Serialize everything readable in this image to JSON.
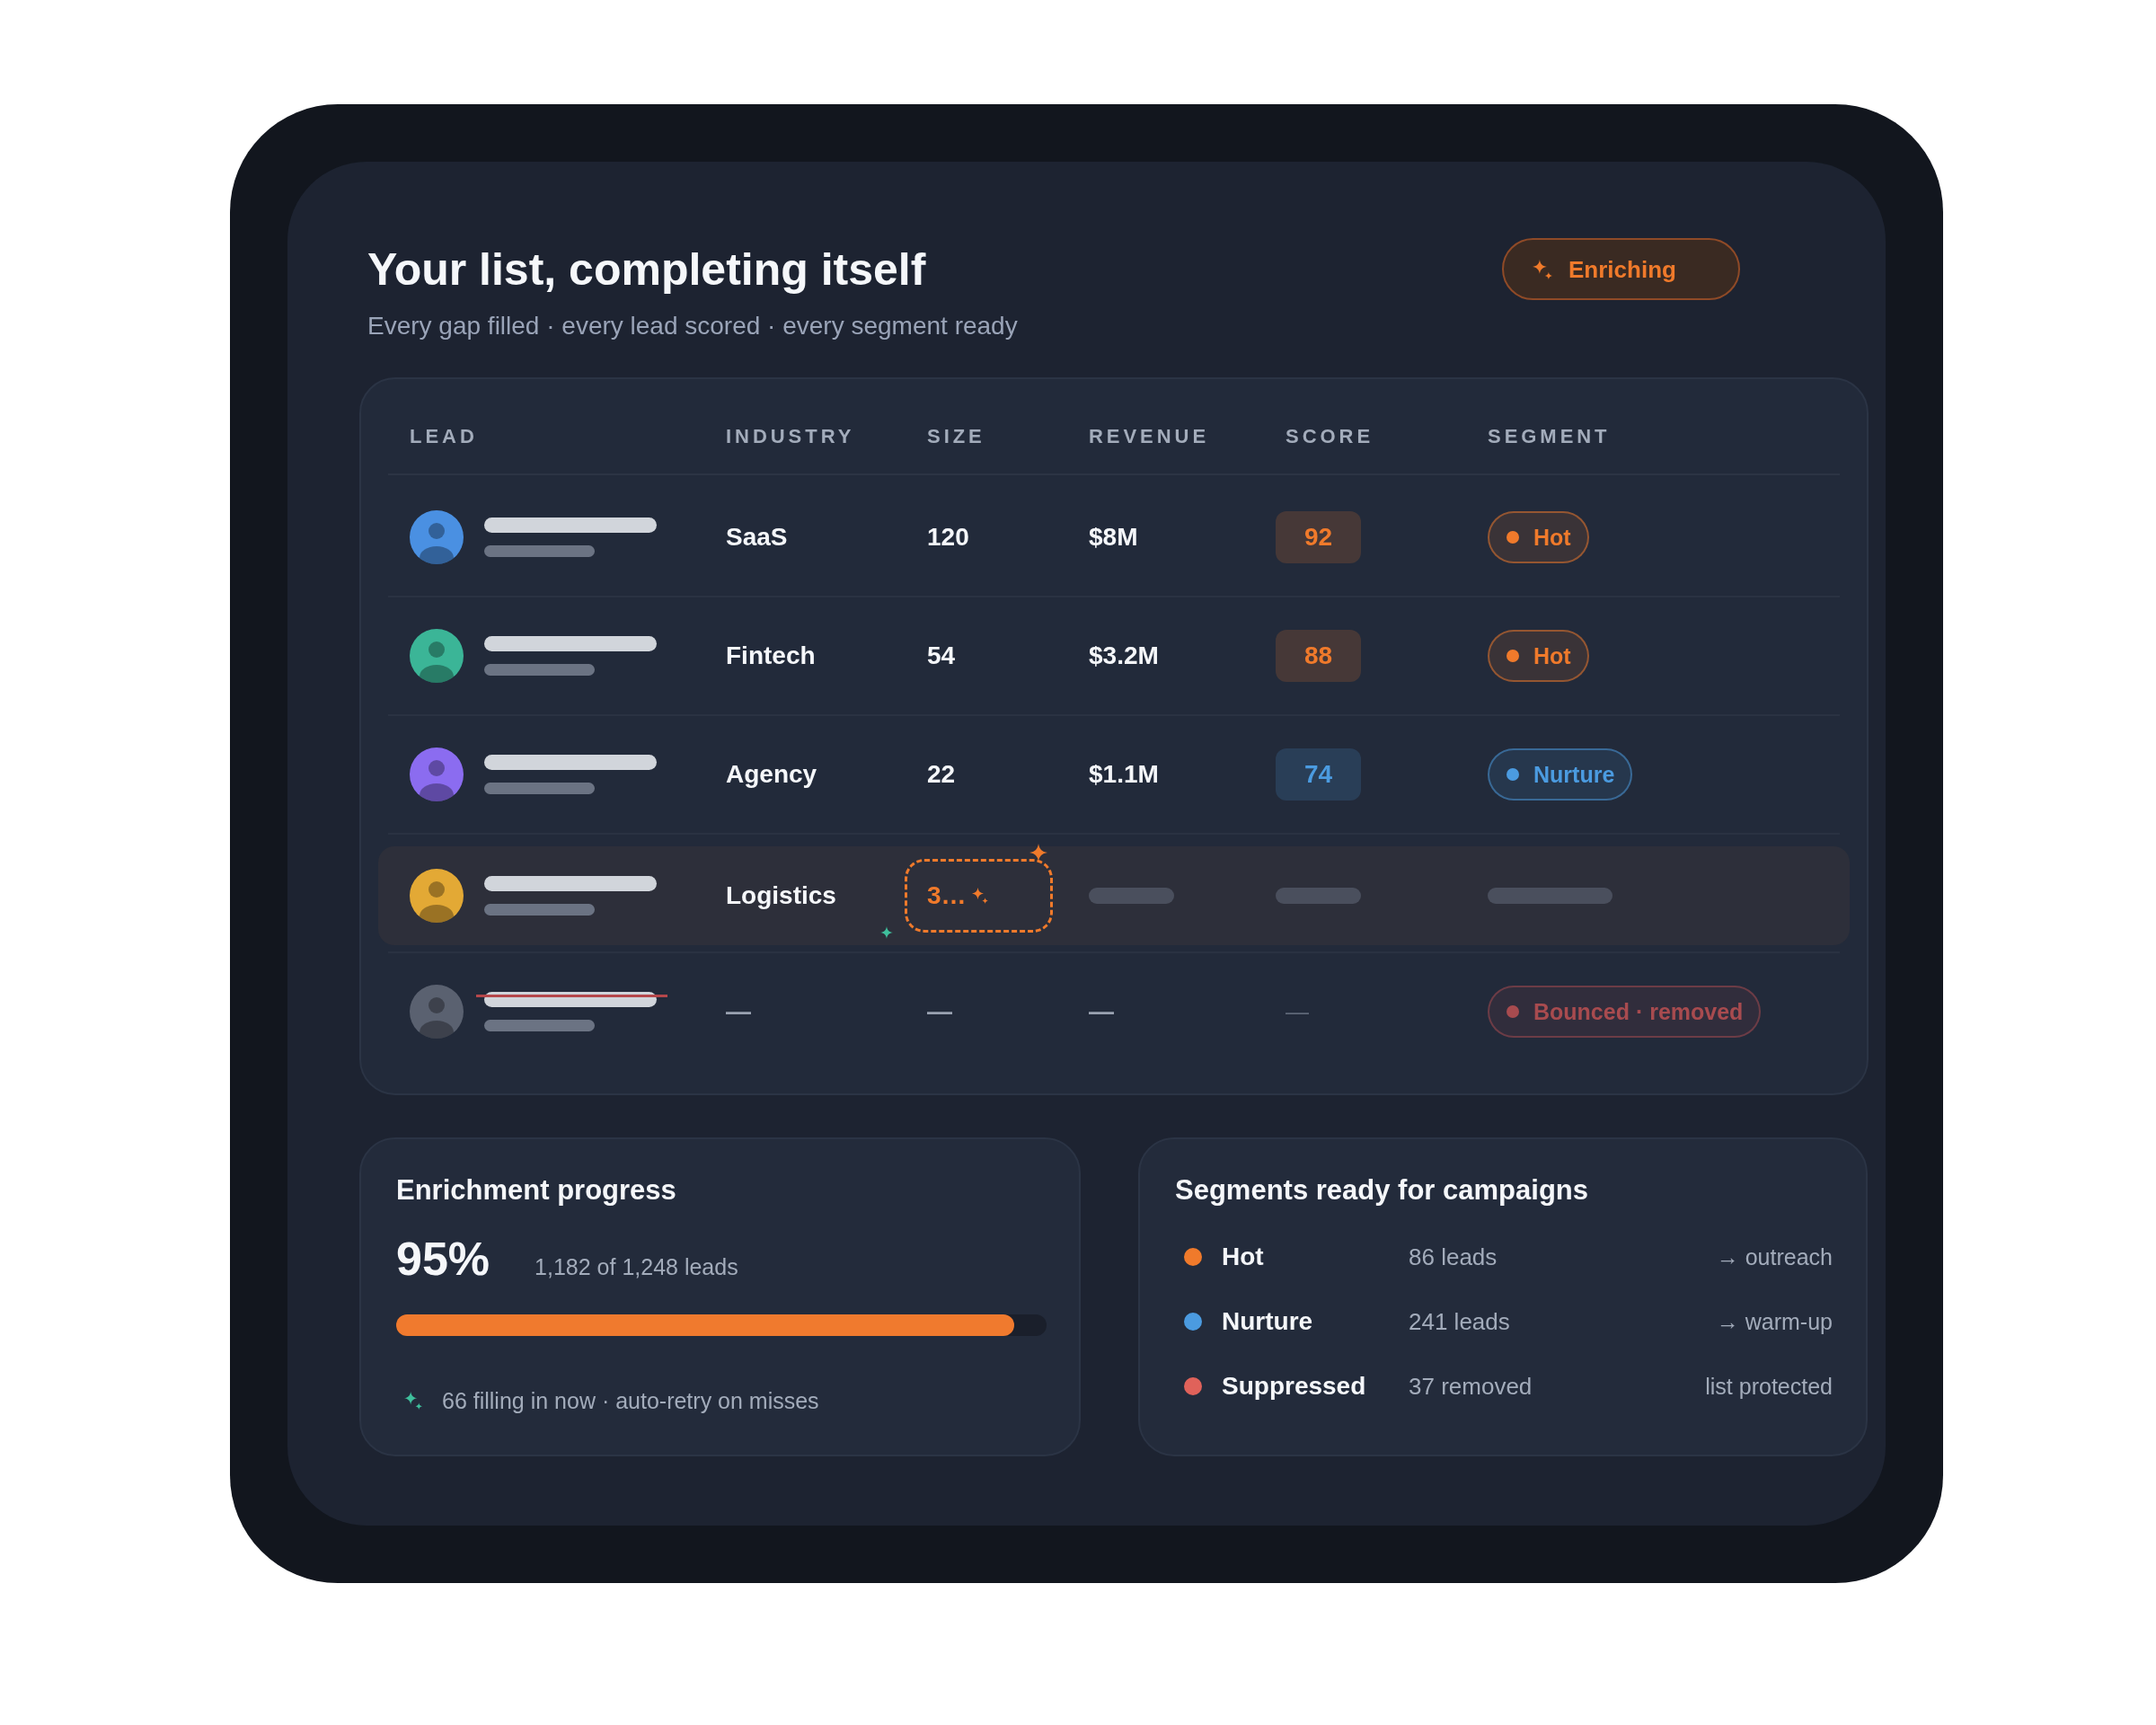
{
  "header": {
    "title": "Your list, completing itself",
    "subtitle": "Every gap filled · every lead scored · every segment ready",
    "status": {
      "label": "Enriching"
    }
  },
  "table": {
    "columns": [
      "LEAD",
      "INDUSTRY",
      "SIZE",
      "REVENUE",
      "SCORE",
      "SEGMENT"
    ],
    "rows": [
      {
        "kind": "scored",
        "color": "#4a90e2",
        "industry": "SaaS",
        "size": "120",
        "revenue": "$8M",
        "score": "92",
        "segment": {
          "label": "Hot",
          "color": "#f07a2b"
        }
      },
      {
        "kind": "scored",
        "color": "#3bb597",
        "industry": "Fintech",
        "size": "54",
        "revenue": "$3.2M",
        "score": "88",
        "segment": {
          "label": "Hot",
          "color": "#f07a2b"
        }
      },
      {
        "kind": "scored",
        "color": "#8b6cf0",
        "industry": "Agency",
        "size": "22",
        "revenue": "$1.1M",
        "score": "74",
        "segment": {
          "label": "Nurture",
          "color": "#4b9be0"
        }
      },
      {
        "kind": "enriching",
        "color": "#e3a935",
        "industry": "Logistics",
        "size": "3…"
      },
      {
        "kind": "bounced",
        "color": "#5a6170",
        "industry": "—",
        "size": "—",
        "revenue": "—",
        "score": "—",
        "segment": {
          "label": "Bounced · removed",
          "color": "#a84b4f"
        }
      }
    ]
  },
  "progress": {
    "title": "Enrichment progress",
    "percent": "95%",
    "count": "1,182 of 1,248 leads",
    "level": 0.95,
    "note": "66 filling in now · auto-retry on misses"
  },
  "segments": {
    "title": "Segments ready for campaigns",
    "items": [
      {
        "label": "Hot",
        "count": "86 leads",
        "action": "→ outreach",
        "color": "#f07a2b"
      },
      {
        "label": "Nurture",
        "count": "241 leads",
        "action": "→ warm-up",
        "color": "#4b9be0"
      },
      {
        "label": "Suppressed",
        "count": "37 removed",
        "action": "list protected",
        "color": "#e0625a"
      }
    ]
  }
}
